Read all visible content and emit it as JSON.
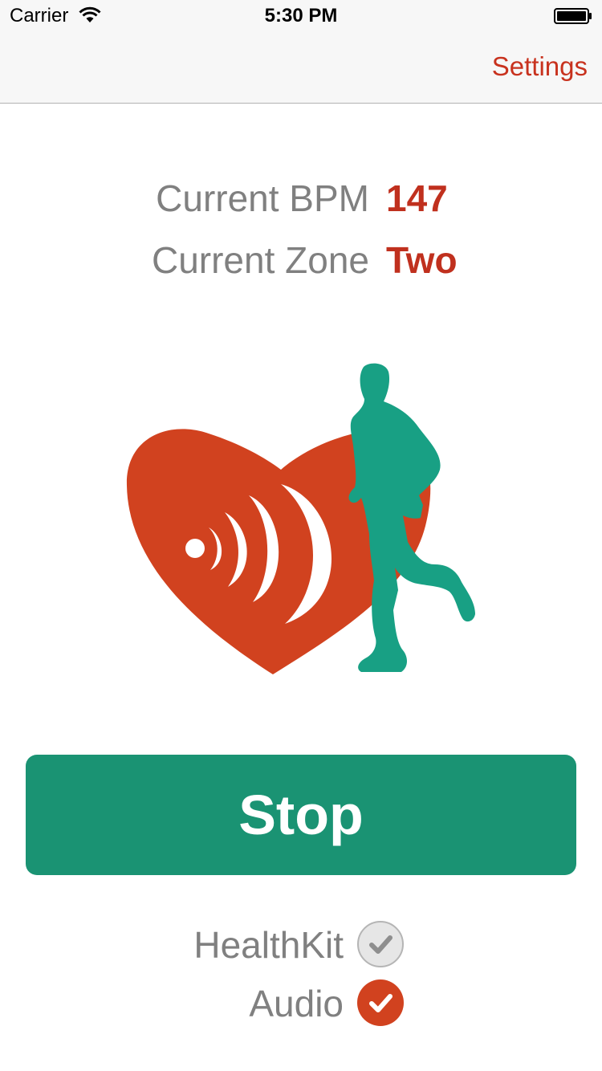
{
  "status_bar": {
    "carrier": "Carrier",
    "time": "5:30 PM"
  },
  "nav": {
    "settings_label": "Settings"
  },
  "stats": {
    "bpm_label": "Current BPM",
    "bpm_value": "147",
    "zone_label": "Current Zone",
    "zone_value": "Two"
  },
  "actions": {
    "stop_label": "Stop"
  },
  "options": {
    "healthkit_label": "HealthKit",
    "healthkit_checked": false,
    "audio_label": "Audio",
    "audio_checked": true
  },
  "colors": {
    "accent_red": "#c8321e",
    "heart": "#d1421f",
    "runner": "#18a084",
    "button_green": "#1a9373"
  },
  "icons": {
    "hero": "heart-pulse-runner-icon",
    "healthkit_check": "checkmark-circle-icon",
    "audio_check": "checkmark-circle-icon"
  }
}
